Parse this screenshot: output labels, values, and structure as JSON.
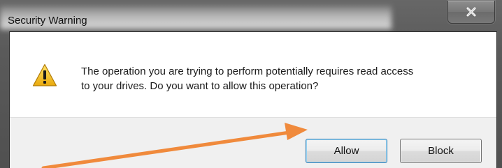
{
  "window": {
    "title": "Security Warning",
    "close_icon": "close-icon"
  },
  "message": {
    "icon": "warning-icon",
    "line1": "The operation you are trying to perform potentially requires read access",
    "line2": "to your drives. Do you want to allow this operation?"
  },
  "buttons": {
    "allow_label": "Allow",
    "block_label": "Block"
  },
  "colors": {
    "annotation_arrow": "#f08a3c",
    "warning_fill": "#f3c21a"
  }
}
